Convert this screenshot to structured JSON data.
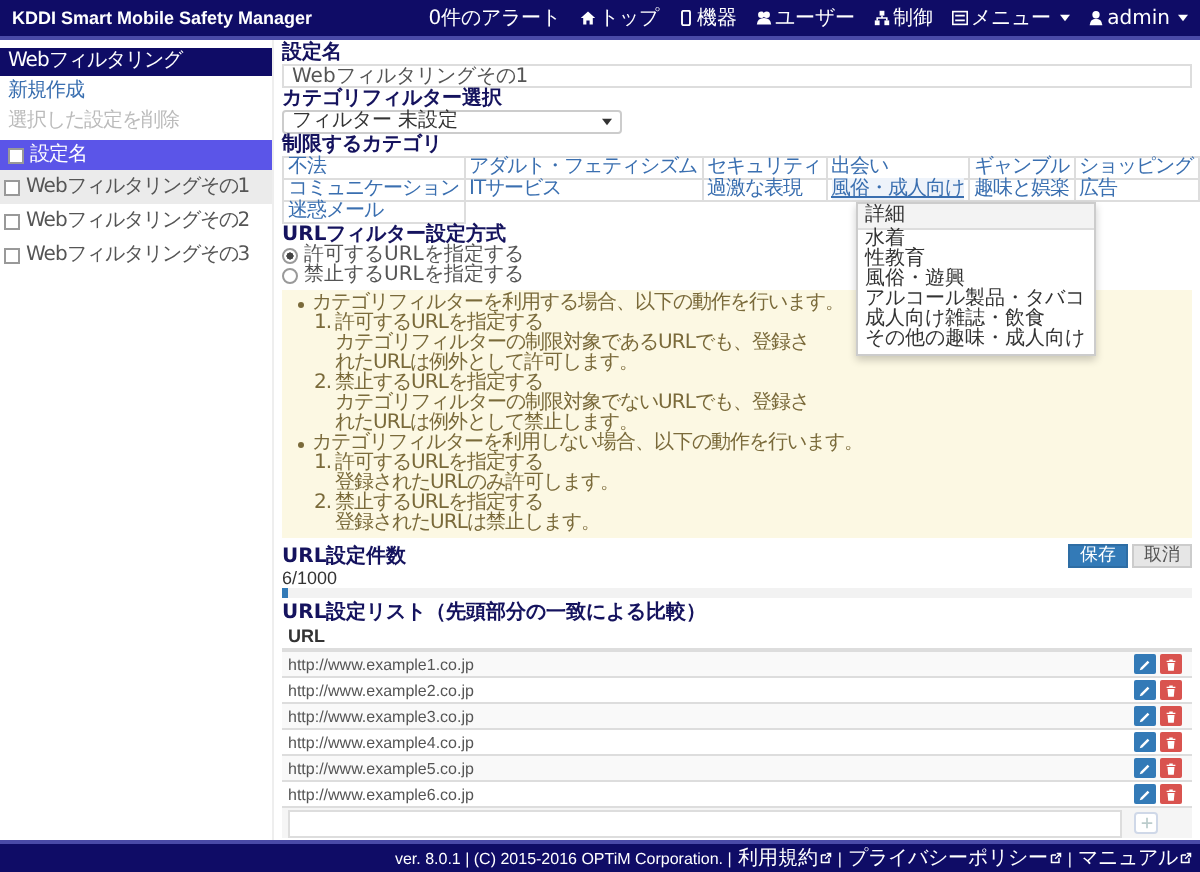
{
  "app": {
    "title": "KDDI Smart Mobile Safety Manager"
  },
  "nav": [
    {
      "label": "0件のアラート",
      "dropdown": false
    },
    {
      "label": "トップ",
      "dropdown": false
    },
    {
      "label": "機器",
      "dropdown": false
    },
    {
      "label": "ユーザー",
      "dropdown": false
    },
    {
      "label": "制御",
      "dropdown": false
    },
    {
      "label": "メニュー",
      "dropdown": true
    },
    {
      "label": "admin",
      "dropdown": true
    }
  ],
  "sidebar": {
    "title": "Webフィルタリング",
    "actions": [
      {
        "label": "新規作成",
        "disabled": false
      },
      {
        "label": "選択した設定を削除",
        "disabled": true
      }
    ],
    "header": "設定名",
    "header_checked": false,
    "items": [
      {
        "label": "Webフィルタリングその1",
        "selected": true,
        "checked": false
      },
      {
        "label": "Webフィルタリングその2",
        "selected": false,
        "checked": false
      },
      {
        "label": "Webフィルタリングその3",
        "selected": false,
        "checked": false
      }
    ]
  },
  "form": {
    "name_label": "設定名",
    "name_value": "Webフィルタリングその1",
    "filter_label": "カテゴリフィルター選択",
    "filter_value": "フィルター 未設定",
    "categories_label": "制限するカテゴリ",
    "categories": [
      [
        {
          "label": "不法",
          "expanded": false
        },
        {
          "label": "アダルト・フェティシズム",
          "expanded": false
        },
        {
          "label": "セキュリティ",
          "expanded": false
        },
        {
          "label": "出会い",
          "expanded": false
        },
        {
          "label": "ギャンブル",
          "expanded": false
        },
        {
          "label": "ショッピング",
          "expanded": false
        }
      ],
      [
        {
          "label": "コミュニケーション",
          "expanded": false
        },
        {
          "label": "ITサービス",
          "expanded": false
        },
        {
          "label": "過激な表現",
          "expanded": false
        },
        {
          "label": "風俗・成人向け",
          "expanded": true
        },
        {
          "label": "趣味と娯楽",
          "expanded": false
        },
        {
          "label": "広告",
          "expanded": false
        }
      ],
      [
        {
          "label": "迷惑メール",
          "expanded": false
        }
      ]
    ],
    "dropdown": {
      "title": "詳細",
      "items": [
        "水着",
        "性教育",
        "風俗・遊興",
        "アルコール製品・タバコ",
        "成人向け雑誌・飲食",
        "その他の趣味・成人向け"
      ]
    },
    "method_label": "URLフィルター設定方式",
    "methods": [
      {
        "label": "許可するURLを指定する",
        "selected": true
      },
      {
        "label": "禁止するURLを指定する",
        "selected": false
      }
    ],
    "info": [
      {
        "text": "カテゴリフィルターを利用する場合、以下の動作を行います。",
        "steps": [
          {
            "num": "1.",
            "title": "許可するURLを指定する",
            "text": "カテゴリフィルターの制限対象であるURLでも、登録されたURLは例外として許可します。"
          },
          {
            "num": "2.",
            "title": "禁止するURLを指定する",
            "text": "カテゴリフィルターの制限対象でないURLでも、登録されたURLは例外として禁止します。"
          }
        ]
      },
      {
        "text": "カテゴリフィルターを利用しない場合、以下の動作を行います。",
        "steps": [
          {
            "num": "1.",
            "title": "許可するURLを指定する",
            "text": "登録されたURLのみ許可します。"
          },
          {
            "num": "2.",
            "title": "禁止するURLを指定する",
            "text": "登録されたURLは禁止します。"
          }
        ]
      }
    ]
  },
  "buttons": [
    {
      "label": "保存",
      "kind": "primary"
    },
    {
      "label": "取消",
      "kind": "default"
    }
  ],
  "count": {
    "label": "URL設定件数",
    "value": "6/1000",
    "level": 0.006
  },
  "url_list": {
    "label": "URL設定リスト（先頭部分の一致による比較）",
    "column": "URL",
    "rows": [
      "http://www.example1.co.jp",
      "http://www.example2.co.jp",
      "http://www.example3.co.jp",
      "http://www.example4.co.jp",
      "http://www.example5.co.jp",
      "http://www.example6.co.jp"
    ]
  },
  "footer": {
    "text": "ver. 8.0.1 | (C) 2015-2016 OPTiM Corporation. |",
    "links": [
      "利用規約",
      "プライバシーポリシー",
      "マニュアル"
    ],
    "separator": "|"
  }
}
